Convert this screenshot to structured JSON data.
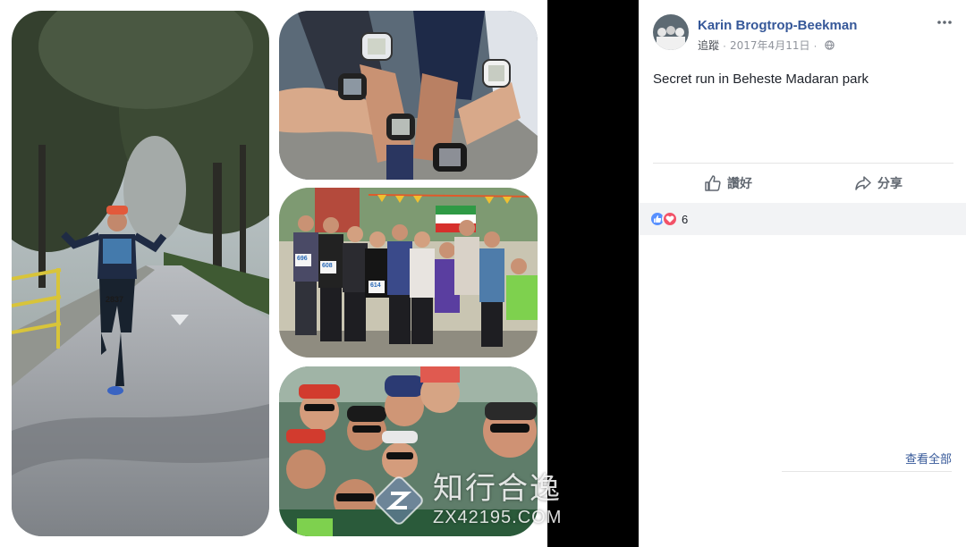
{
  "post": {
    "author": "Karin Brogtrop-Beekman",
    "follow_label": "追蹤",
    "date": "2017年4月11日",
    "caption": "Secret run in Beheste Madaran park",
    "more_icon": "more-options-icon",
    "privacy_icon": "globe-icon"
  },
  "actions": {
    "like_label": "讚好",
    "share_label": "分享"
  },
  "reactions": {
    "types": [
      "like",
      "love"
    ],
    "count": "6"
  },
  "comments": {
    "see_all_label": "查看全部"
  },
  "photo": {
    "watermark_cn": "知行合逸",
    "watermark_url": "ZX42195.COM",
    "bib_runner": "2837",
    "bibs_group": [
      "696",
      "608",
      "614"
    ]
  },
  "colors": {
    "link": "#365899",
    "like_reaction": "#5890ff",
    "love_reaction": "#f25268",
    "panel_bg": "#ffffff",
    "viewer_bg": "#000000"
  }
}
